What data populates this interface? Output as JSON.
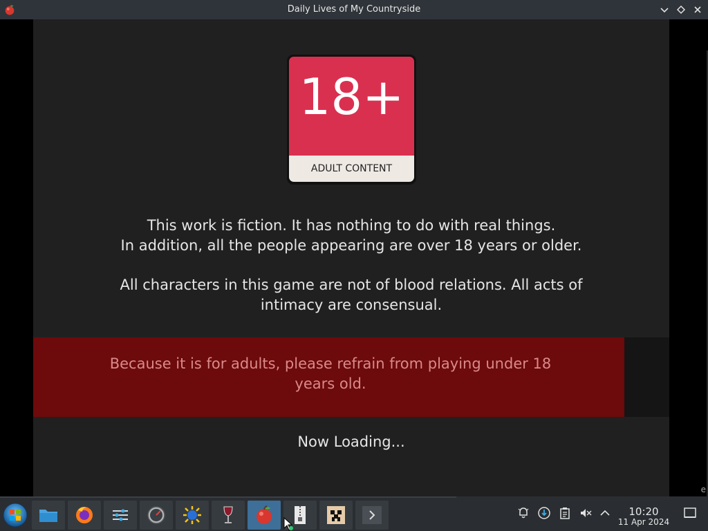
{
  "window": {
    "title": "Daily Lives of My Countryside",
    "minimize_icon": "chevron-down-icon",
    "maximize_icon": "diamond-icon",
    "close_icon": "close-icon"
  },
  "game": {
    "badge_number": "18+",
    "badge_label": "ADULT CONTENT",
    "notice_line1": "This work is fiction. It has nothing to do with real things.",
    "notice_line2": "In addition, all the people appearing are over 18 years or older.",
    "notice_para2": "All characters in this game are not of blood relations. All acts of intimacy are consensual.",
    "warning": "Because it is for adults, please refrain from playing under 18 years old.",
    "loading": "Now Loading...",
    "edge_letter": "e"
  },
  "taskbar": {
    "items": [
      {
        "name": "start-menu",
        "icon": "start-orb-icon"
      },
      {
        "name": "file-manager",
        "icon": "folder-icon"
      },
      {
        "name": "firefox",
        "icon": "firefox-icon"
      },
      {
        "name": "settings",
        "icon": "sliders-icon"
      },
      {
        "name": "speedometer",
        "icon": "gauge-icon"
      },
      {
        "name": "sun-app",
        "icon": "sun-icon"
      },
      {
        "name": "wine",
        "icon": "wine-glass-icon"
      },
      {
        "name": "game-window",
        "icon": "apple-icon"
      },
      {
        "name": "archive",
        "icon": "zipper-icon"
      },
      {
        "name": "minecraft",
        "icon": "creeper-icon"
      },
      {
        "name": "terminal",
        "icon": "terminal-icon"
      }
    ],
    "tray": [
      "bell-icon",
      "updates-icon",
      "clipboard-icon",
      "volume-muted-icon",
      "chevron-up-icon"
    ],
    "time": "10:20",
    "date": "11 Apr 2024",
    "show_desktop_icon": "desktop-icon"
  },
  "colors": {
    "badge_red": "#da3050",
    "banner_red": "#6d0a0b",
    "game_bg": "#202020",
    "active_task": "#3d6f99"
  }
}
